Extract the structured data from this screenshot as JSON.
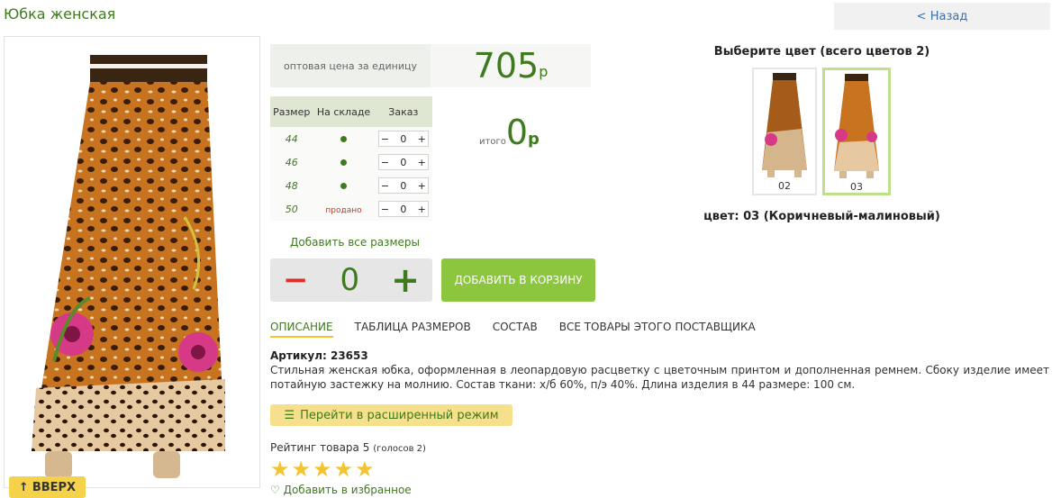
{
  "page": {
    "title": "Юбка женская",
    "back_label": "< Назад",
    "up_label": "ВВЕРХ"
  },
  "price": {
    "label": "оптовая цена за единицу",
    "value": "705",
    "currency": "р"
  },
  "size_table": {
    "headers": [
      "Размер",
      "На складе",
      "Заказ"
    ],
    "rows": [
      {
        "size": "44",
        "stock": "dot",
        "qty": "0"
      },
      {
        "size": "46",
        "stock": "dot",
        "qty": "0"
      },
      {
        "size": "48",
        "stock": "dot",
        "qty": "0"
      },
      {
        "size": "50",
        "stock": "продано",
        "qty": "0"
      }
    ],
    "minus": "−",
    "plus": "+"
  },
  "total": {
    "label": "итого",
    "value": "0",
    "currency": "р"
  },
  "add_all_sizes": "Добавить все размеры",
  "quantity": {
    "minus": "−",
    "value": "0",
    "plus": "+"
  },
  "cart_button": "ДОБАВИТЬ В КОРЗИНУ",
  "tabs": [
    {
      "label": "ОПИСАНИЕ",
      "active": true
    },
    {
      "label": "ТАБЛИЦА РАЗМЕРОВ",
      "active": false
    },
    {
      "label": "СОСТАВ",
      "active": false
    },
    {
      "label": "ВСЕ ТОВАРЫ ЭТОГО ПОСТАВЩИКА",
      "active": false
    }
  ],
  "article": "Артикул: 23653",
  "description": "Стильная женская юбка, оформленная в леопардовую расцветку с цветочным принтом и дополненная ремнем. Сбоку изделие имеет потайную застежку на молнию. Состав ткани: х/б 60%, п/э 40%. Длина изделия в 44 размере: 100 см.",
  "advanced_mode": "Перейти в расширенный режим",
  "rating": {
    "text": "Рейтинг товара 5",
    "votes": "(голосов 2)",
    "stars": 5
  },
  "favorite": "Добавить в избранное",
  "colors": {
    "title": "Выберите цвет (всего цветов 2)",
    "items": [
      {
        "label": "02",
        "selected": false
      },
      {
        "label": "03",
        "selected": true
      }
    ],
    "current": "цвет: 03 (Коричневый-малиновый)"
  },
  "palette": {
    "accent": "#3f7a1e",
    "cart_green": "#8cc63e",
    "star": "#f4c430",
    "minus_red": "#d9302b"
  }
}
